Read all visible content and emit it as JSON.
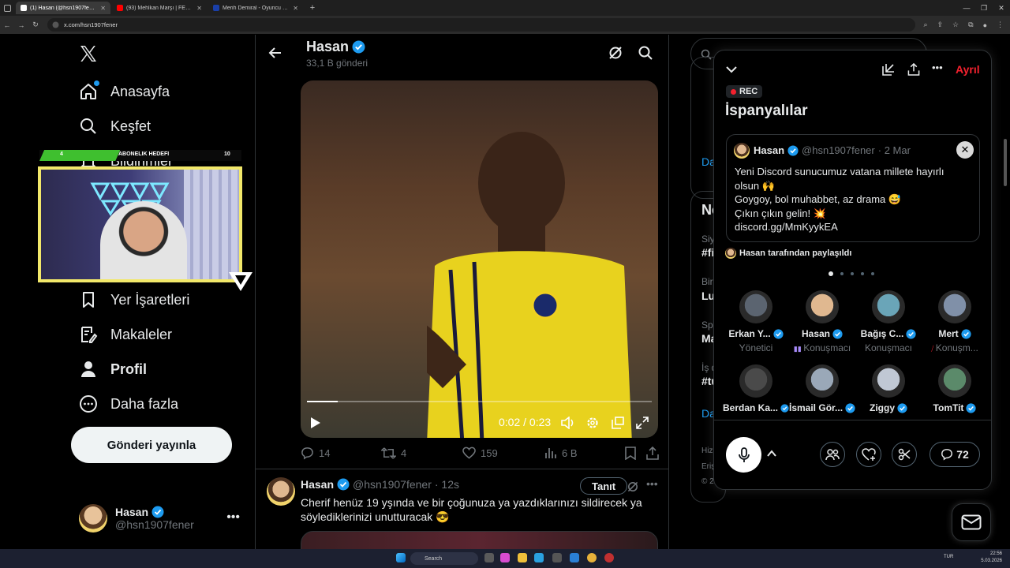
{
  "browser": {
    "tabs": [
      {
        "title": "(1) Hasan (@hsn1907fener)",
        "color": "#ffffff",
        "active": true
      },
      {
        "title": "(93) Mehlkan Marşı | FENERBAHÇE",
        "color": "#ff0000",
        "active": false
      },
      {
        "title": "Merih Demiral - Oyuncu profili",
        "color": "#1a3fa8",
        "active": false
      }
    ],
    "url": "x.com/hsn1907fener"
  },
  "sidebar": {
    "items": [
      {
        "label": "Anasayfa",
        "icon": "home-icon"
      },
      {
        "label": "Keşfet",
        "icon": "search-icon"
      },
      {
        "label": "Bildirimler",
        "icon": "bell-icon"
      },
      {
        "label": "Yer İşaretleri",
        "icon": "bookmark-icon"
      },
      {
        "label": "Makaleler",
        "icon": "article-icon"
      },
      {
        "label": "Profil",
        "icon": "person-icon"
      },
      {
        "label": "Daha fazla",
        "icon": "more-circle-icon"
      }
    ],
    "post_button": "Gönderi yayınla",
    "account": {
      "name": "Hasan",
      "handle": "@hsn1907fener"
    }
  },
  "overlay": {
    "left_value": "4",
    "label": "ABONELIK HEDEFI",
    "right_value": "10",
    "progress": 0.4
  },
  "profile_header": {
    "name": "Hasan",
    "posts": "33,1 B gönderi"
  },
  "video": {
    "time": "0:02 / 0:23",
    "progress": 0.09
  },
  "tweet_actions": {
    "replies": "14",
    "reposts": "4",
    "likes": "159",
    "views": "6 B"
  },
  "tweet2": {
    "name": "Hasan",
    "handle": "@hsn1907fener",
    "time": "· 12s",
    "button": "Tanıt",
    "text": "Cherif henüz 19 yşında ve bir çoğunuza ya yazdıklarınızı sildirecek ya söylediklerinizi unutturacak 😎"
  },
  "right_column": {
    "partial": [
      "Da",
      "Ne",
      "Siy",
      "#fi",
      "Birl",
      "Lu",
      "Spo",
      "Ma",
      "İş d",
      "#tu",
      "Da",
      "Hizi",
      "Erişi",
      "© 2"
    ]
  },
  "space": {
    "leave": "Ayrıl",
    "rec": "REC",
    "title": "İspanyalılar",
    "pinned": {
      "name": "Hasan",
      "handle": "@hsn1907fener",
      "date": "· 2 Mar",
      "lines": [
        "Yeni Discord sunucumuz vatana millete hayırlı olsun 🙌",
        "Goygoy, bol muhabbet, az drama 😅",
        "Çıkın çıkın gelin! 💥",
        " discord.gg/MmKyykEA"
      ]
    },
    "shared_by": "Hasan tarafından paylaşıldı",
    "speakers": [
      {
        "name": "Erkan Y...",
        "role": "Yönetici",
        "color": "#5b6470"
      },
      {
        "name": "Hasan",
        "role": "Konuşmacı",
        "color": "#e0b890"
      },
      {
        "name": "Bağış C...",
        "role": "Konuşmacı",
        "color": "#6aa5b8"
      },
      {
        "name": "Mert",
        "role": "Konuşm...",
        "color": "#8090a8"
      },
      {
        "name": "Berdan Ka...",
        "role": "",
        "color": "#4a4a4a"
      },
      {
        "name": "İsmail Gör...",
        "role": "",
        "color": "#9aa8b8"
      },
      {
        "name": "Ziggy",
        "role": "",
        "color": "#c0c8d4"
      },
      {
        "name": "TomTit",
        "role": "",
        "color": "#5b8a6a"
      }
    ],
    "comment_count": "72"
  },
  "taskbar": {
    "search": "Search",
    "lang": "TUR",
    "time": "22:56",
    "date": "5.03.2026"
  },
  "colors": {
    "accent": "#1d9bf0",
    "leave_red": "#f4212e",
    "overlay_yellow": "#f2e86a",
    "overlay_green": "#3fbf2f"
  }
}
